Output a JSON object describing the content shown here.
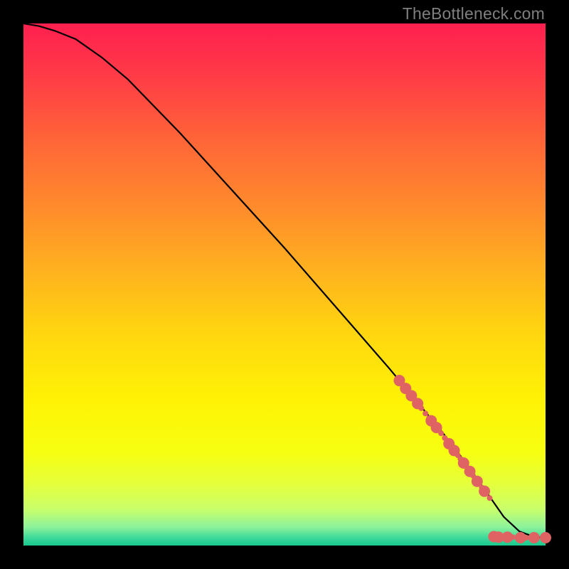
{
  "watermark": "TheBottleneck.com",
  "chart_data": {
    "type": "line",
    "title": "",
    "xlabel": "",
    "ylabel": "",
    "xlim": [
      0,
      100
    ],
    "ylim": [
      0,
      100
    ],
    "curve": {
      "name": "main-curve",
      "x": [
        0,
        3,
        6,
        10,
        15,
        20,
        30,
        40,
        50,
        60,
        70,
        75,
        80,
        85,
        89,
        92,
        95,
        98,
        100
      ],
      "y": [
        100,
        99.5,
        98.6,
        97,
        93.5,
        89.3,
        79,
        68,
        57,
        45.5,
        34,
        28,
        22,
        15.5,
        9.8,
        5.5,
        2.7,
        1.6,
        1.5
      ]
    },
    "markers": {
      "name": "points",
      "color": "#e06363",
      "r_small": 4,
      "r_large": 8,
      "points": [
        {
          "x": 72.0,
          "y": 31.6,
          "r": 8
        },
        {
          "x": 73.2,
          "y": 30.1,
          "r": 8
        },
        {
          "x": 74.3,
          "y": 28.7,
          "r": 8
        },
        {
          "x": 75.5,
          "y": 27.2,
          "r": 8
        },
        {
          "x": 76.2,
          "y": 26.3,
          "r": 4
        },
        {
          "x": 77.0,
          "y": 25.3,
          "r": 4
        },
        {
          "x": 77.7,
          "y": 24.4,
          "r": 4
        },
        {
          "x": 78.1,
          "y": 23.9,
          "r": 8
        },
        {
          "x": 79.1,
          "y": 22.6,
          "r": 8
        },
        {
          "x": 80.0,
          "y": 21.5,
          "r": 4
        },
        {
          "x": 80.7,
          "y": 20.6,
          "r": 4
        },
        {
          "x": 81.5,
          "y": 19.5,
          "r": 8
        },
        {
          "x": 82.5,
          "y": 18.2,
          "r": 8
        },
        {
          "x": 83.2,
          "y": 17.3,
          "r": 4
        },
        {
          "x": 83.7,
          "y": 16.6,
          "r": 4
        },
        {
          "x": 84.3,
          "y": 15.8,
          "r": 8
        },
        {
          "x": 85.5,
          "y": 14.2,
          "r": 8
        },
        {
          "x": 86.1,
          "y": 13.4,
          "r": 4
        },
        {
          "x": 86.9,
          "y": 12.3,
          "r": 8
        },
        {
          "x": 87.8,
          "y": 11.1,
          "r": 4
        },
        {
          "x": 88.3,
          "y": 10.4,
          "r": 8
        },
        {
          "x": 89.3,
          "y": 9.1,
          "r": 4
        },
        {
          "x": 90.1,
          "y": 1.7,
          "r": 8
        },
        {
          "x": 91.0,
          "y": 1.6,
          "r": 8
        },
        {
          "x": 91.8,
          "y": 1.6,
          "r": 4
        },
        {
          "x": 92.7,
          "y": 1.6,
          "r": 8
        },
        {
          "x": 93.7,
          "y": 1.6,
          "r": 4
        },
        {
          "x": 95.2,
          "y": 1.5,
          "r": 8
        },
        {
          "x": 96.3,
          "y": 1.5,
          "r": 4
        },
        {
          "x": 97.8,
          "y": 1.5,
          "r": 8
        },
        {
          "x": 100.0,
          "y": 1.5,
          "r": 8
        }
      ]
    },
    "gradient_stops": [
      {
        "offset": 0.0,
        "color": "#ff1f4f"
      },
      {
        "offset": 0.1,
        "color": "#ff3b47"
      },
      {
        "offset": 0.22,
        "color": "#ff6438"
      },
      {
        "offset": 0.35,
        "color": "#ff8a2c"
      },
      {
        "offset": 0.48,
        "color": "#ffb41e"
      },
      {
        "offset": 0.6,
        "color": "#ffd80f"
      },
      {
        "offset": 0.72,
        "color": "#fff205"
      },
      {
        "offset": 0.82,
        "color": "#f7ff10"
      },
      {
        "offset": 0.88,
        "color": "#e6ff3a"
      },
      {
        "offset": 0.93,
        "color": "#c9ff6a"
      },
      {
        "offset": 0.965,
        "color": "#8cf29b"
      },
      {
        "offset": 0.985,
        "color": "#3dd99a"
      },
      {
        "offset": 1.0,
        "color": "#18c98f"
      }
    ]
  }
}
